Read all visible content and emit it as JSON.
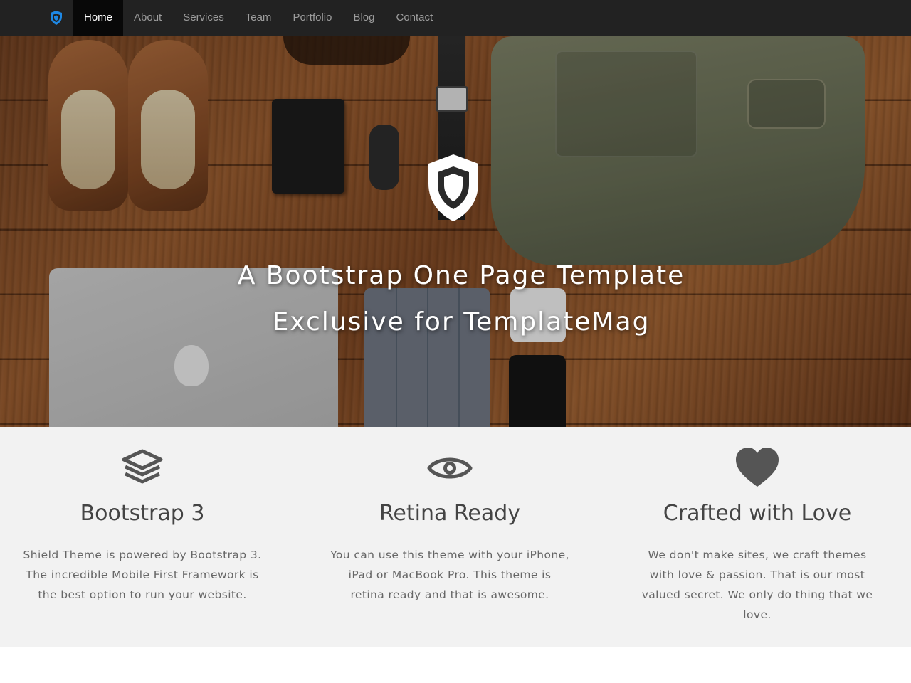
{
  "navbar": {
    "brand_icon": "shield-icon",
    "items": [
      {
        "label": "Home",
        "active": true
      },
      {
        "label": "About",
        "active": false
      },
      {
        "label": "Services",
        "active": false
      },
      {
        "label": "Team",
        "active": false
      },
      {
        "label": "Portfolio",
        "active": false
      },
      {
        "label": "Blog",
        "active": false
      },
      {
        "label": "Contact",
        "active": false
      }
    ]
  },
  "hero": {
    "logo_icon": "shield-icon",
    "title_line1": "A Bootstrap One Page Template",
    "title_line2": "Exclusive for TemplateMag"
  },
  "features": [
    {
      "icon": "layers-icon",
      "title": "Bootstrap 3",
      "text": "Shield Theme is powered by Bootstrap 3. The incredible Mobile First Framework is the best option to run your website."
    },
    {
      "icon": "eye-icon",
      "title": "Retina Ready",
      "text": "You can use this theme with your iPhone, iPad or MacBook Pro. This theme is retina ready and that is awesome."
    },
    {
      "icon": "heart-icon",
      "title": "Crafted with Love",
      "text": "We don't make sites, we craft themes with love & passion. That is our most valued secret. We only do thing that we love."
    }
  ],
  "colors": {
    "navbar_bg": "#222222",
    "nav_active_bg": "#080808",
    "brand_accent": "#1e88e5",
    "features_bg": "#f2f2f2",
    "icon_color": "#555555"
  }
}
